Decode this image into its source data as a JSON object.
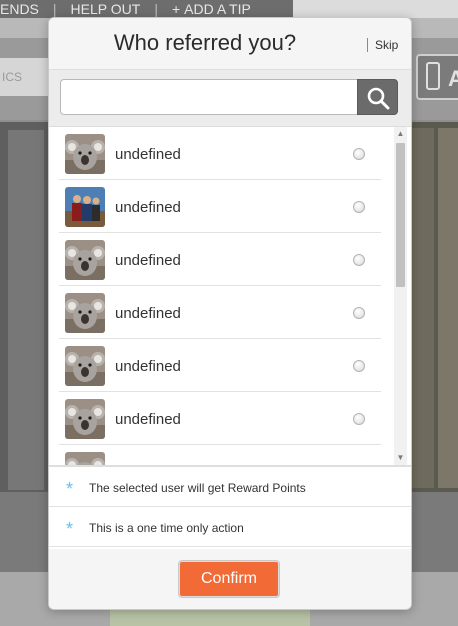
{
  "background_page": {
    "nav_items": [
      "ENDS",
      "HELP OUT",
      "ADD A TIP"
    ],
    "nav_separator": "|",
    "partial_box_text": "ICS",
    "app_button_letter": "A"
  },
  "modal": {
    "title": "Who referred you?",
    "skip_label": "Skip",
    "search": {
      "value": "",
      "placeholder": ""
    },
    "users": [
      {
        "name": "undefined",
        "avatar": "koala-photo",
        "selected": false
      },
      {
        "name": "undefined",
        "avatar": "people-photo",
        "selected": false
      },
      {
        "name": "undefined",
        "avatar": "koala-photo",
        "selected": false
      },
      {
        "name": "undefined",
        "avatar": "koala-photo",
        "selected": false
      },
      {
        "name": "undefined",
        "avatar": "koala-photo",
        "selected": false
      },
      {
        "name": "undefined",
        "avatar": "koala-photo",
        "selected": false
      },
      {
        "name": "",
        "avatar": "koala-photo",
        "selected": false
      }
    ],
    "info": [
      "The selected user will get Reward Points",
      "This is a one time only action"
    ],
    "info_bullet": "*",
    "confirm_label": "Confirm"
  },
  "colors": {
    "accent": "#f26a35",
    "info_bullet": "#6bbde0",
    "search_button": "#6b6b6b"
  },
  "icons": [
    "search-icon",
    "koala-avatar-icon",
    "radio-icon",
    "asterisk-icon",
    "scroll-arrow-up-icon",
    "scroll-arrow-down-icon",
    "phone-icon"
  ]
}
